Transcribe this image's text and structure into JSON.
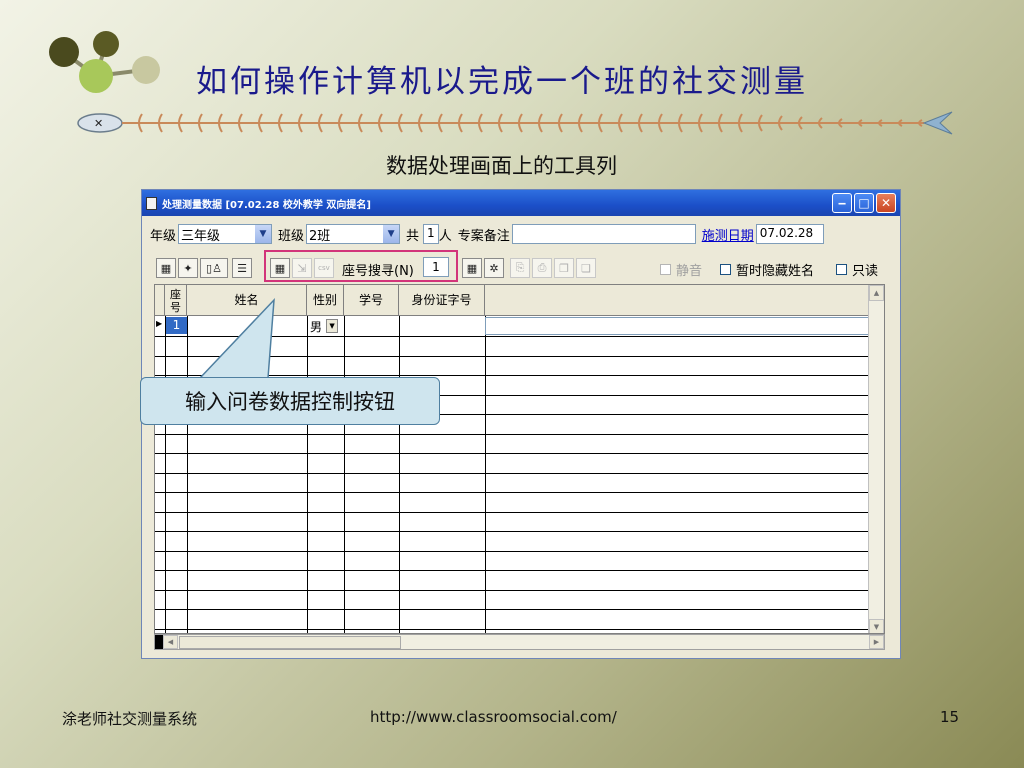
{
  "slide": {
    "title": "如何操作计算机以完成一个班的社交测量",
    "subtitle": "数据处理画面上的工具列",
    "callout": "输入问卷数据控制按钮",
    "footer_left": "涂老师社交测量系统",
    "footer_center": "http://www.classroomsocial.com/",
    "page_number": "15",
    "title_color": "#1a1a8c",
    "highlight_color": "#d2347a"
  },
  "window": {
    "title": "处理测量数据 [07.02.28 校外教学 双向提名]",
    "grade_label": "年级",
    "grade_value": "三年级",
    "class_label": "班级",
    "class_value": "2班",
    "total_label": "共",
    "total_value": "1",
    "total_unit": "人",
    "notes_label": "专案备注",
    "notes_value": "",
    "date_link": "施测日期",
    "date_value": "07.02.28",
    "search_label": "座号搜寻(N)",
    "search_value": "1",
    "mute_label": "静音",
    "hide_names_label": "暂时隐藏姓名",
    "readonly_label": "只读"
  },
  "toolbar_icons": [
    "table-icon",
    "navigate-icon",
    "new-document-icon",
    "list-icon",
    "grid-view-icon",
    "import-icon",
    "csv-icon",
    "grid-icon",
    "network-icon",
    "export-icon",
    "print-icon",
    "copy-icon",
    "paste-icon"
  ],
  "grid": {
    "columns": [
      "座号",
      "姓名",
      "性别",
      "学号",
      "身份证字号"
    ],
    "rows": [
      {
        "seat": "1",
        "name": "",
        "gender": "男",
        "student_id": "",
        "id_number": ""
      }
    ]
  }
}
